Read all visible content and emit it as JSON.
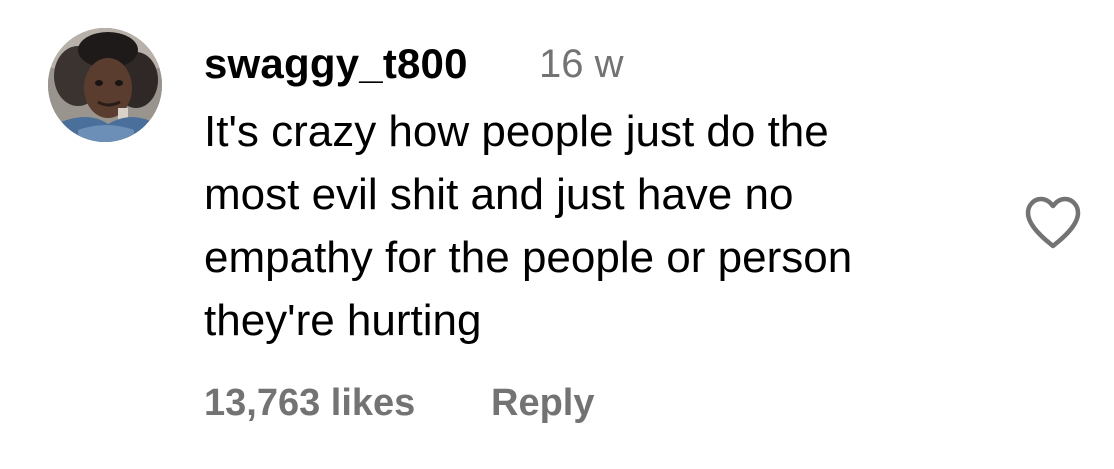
{
  "comment": {
    "avatar_icon": "user-profile-photo",
    "username": "swaggy_t800",
    "timestamp": "16 w",
    "text_lines": [
      "It's crazy how people just do the",
      "most evil shit and just have no",
      "empathy for the people or person",
      "they're hurting"
    ],
    "likes": "13,763 likes",
    "reply_label": "Reply",
    "like_icon": "heart-outline-icon"
  },
  "colors": {
    "text": "#000000",
    "secondary_text": "#737373",
    "background": "#ffffff"
  }
}
